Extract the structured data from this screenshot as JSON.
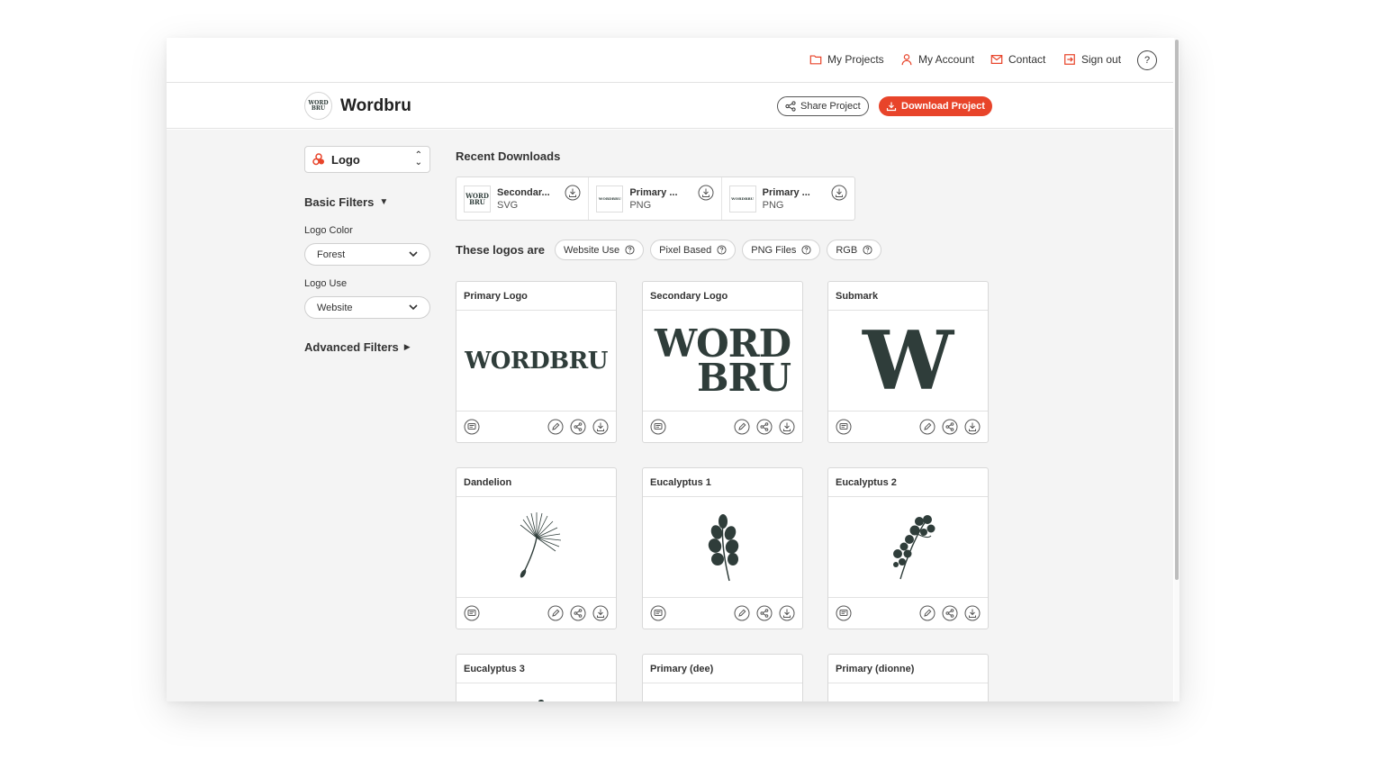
{
  "nav": {
    "my_projects": "My Projects",
    "my_account": "My Account",
    "contact": "Contact",
    "sign_out": "Sign out",
    "help": "?"
  },
  "header": {
    "brand_avatar": "WORD BRU",
    "brand_name": "Wordbru",
    "share_label": "Share Project",
    "download_label": "Download Project"
  },
  "sidebar": {
    "asset_type": "Logo",
    "basic_filters": "Basic Filters",
    "logo_color_label": "Logo Color",
    "logo_color_value": "Forest",
    "logo_use_label": "Logo Use",
    "logo_use_value": "Website",
    "advanced_filters": "Advanced Filters"
  },
  "recent": {
    "title": "Recent Downloads",
    "items": [
      {
        "name": "Secondar...",
        "format": "SVG",
        "thumb": "WORD BRU"
      },
      {
        "name": "Primary ...",
        "format": "PNG",
        "thumb": "WORDBRU"
      },
      {
        "name": "Primary ...",
        "format": "PNG",
        "thumb": "WORDBRU"
      }
    ]
  },
  "tags": {
    "label": "These logos are",
    "items": [
      "Website Use",
      "Pixel Based",
      "PNG Files",
      "RGB"
    ]
  },
  "cards": [
    {
      "title": "Primary Logo",
      "preview": "WORDBRU"
    },
    {
      "title": "Secondary Logo",
      "preview_line1": "WORD",
      "preview_line2": "BRU"
    },
    {
      "title": "Submark",
      "preview": "W"
    },
    {
      "title": "Dandelion"
    },
    {
      "title": "Eucalyptus 1"
    },
    {
      "title": "Eucalyptus 2"
    },
    {
      "title": "Eucalyptus 3"
    },
    {
      "title": "Primary (dee)"
    },
    {
      "title": "Primary (dionne)"
    }
  ],
  "colors": {
    "accent": "#e8442a",
    "logo_forest": "#2f3d3a",
    "background": "#f4f4f4"
  }
}
